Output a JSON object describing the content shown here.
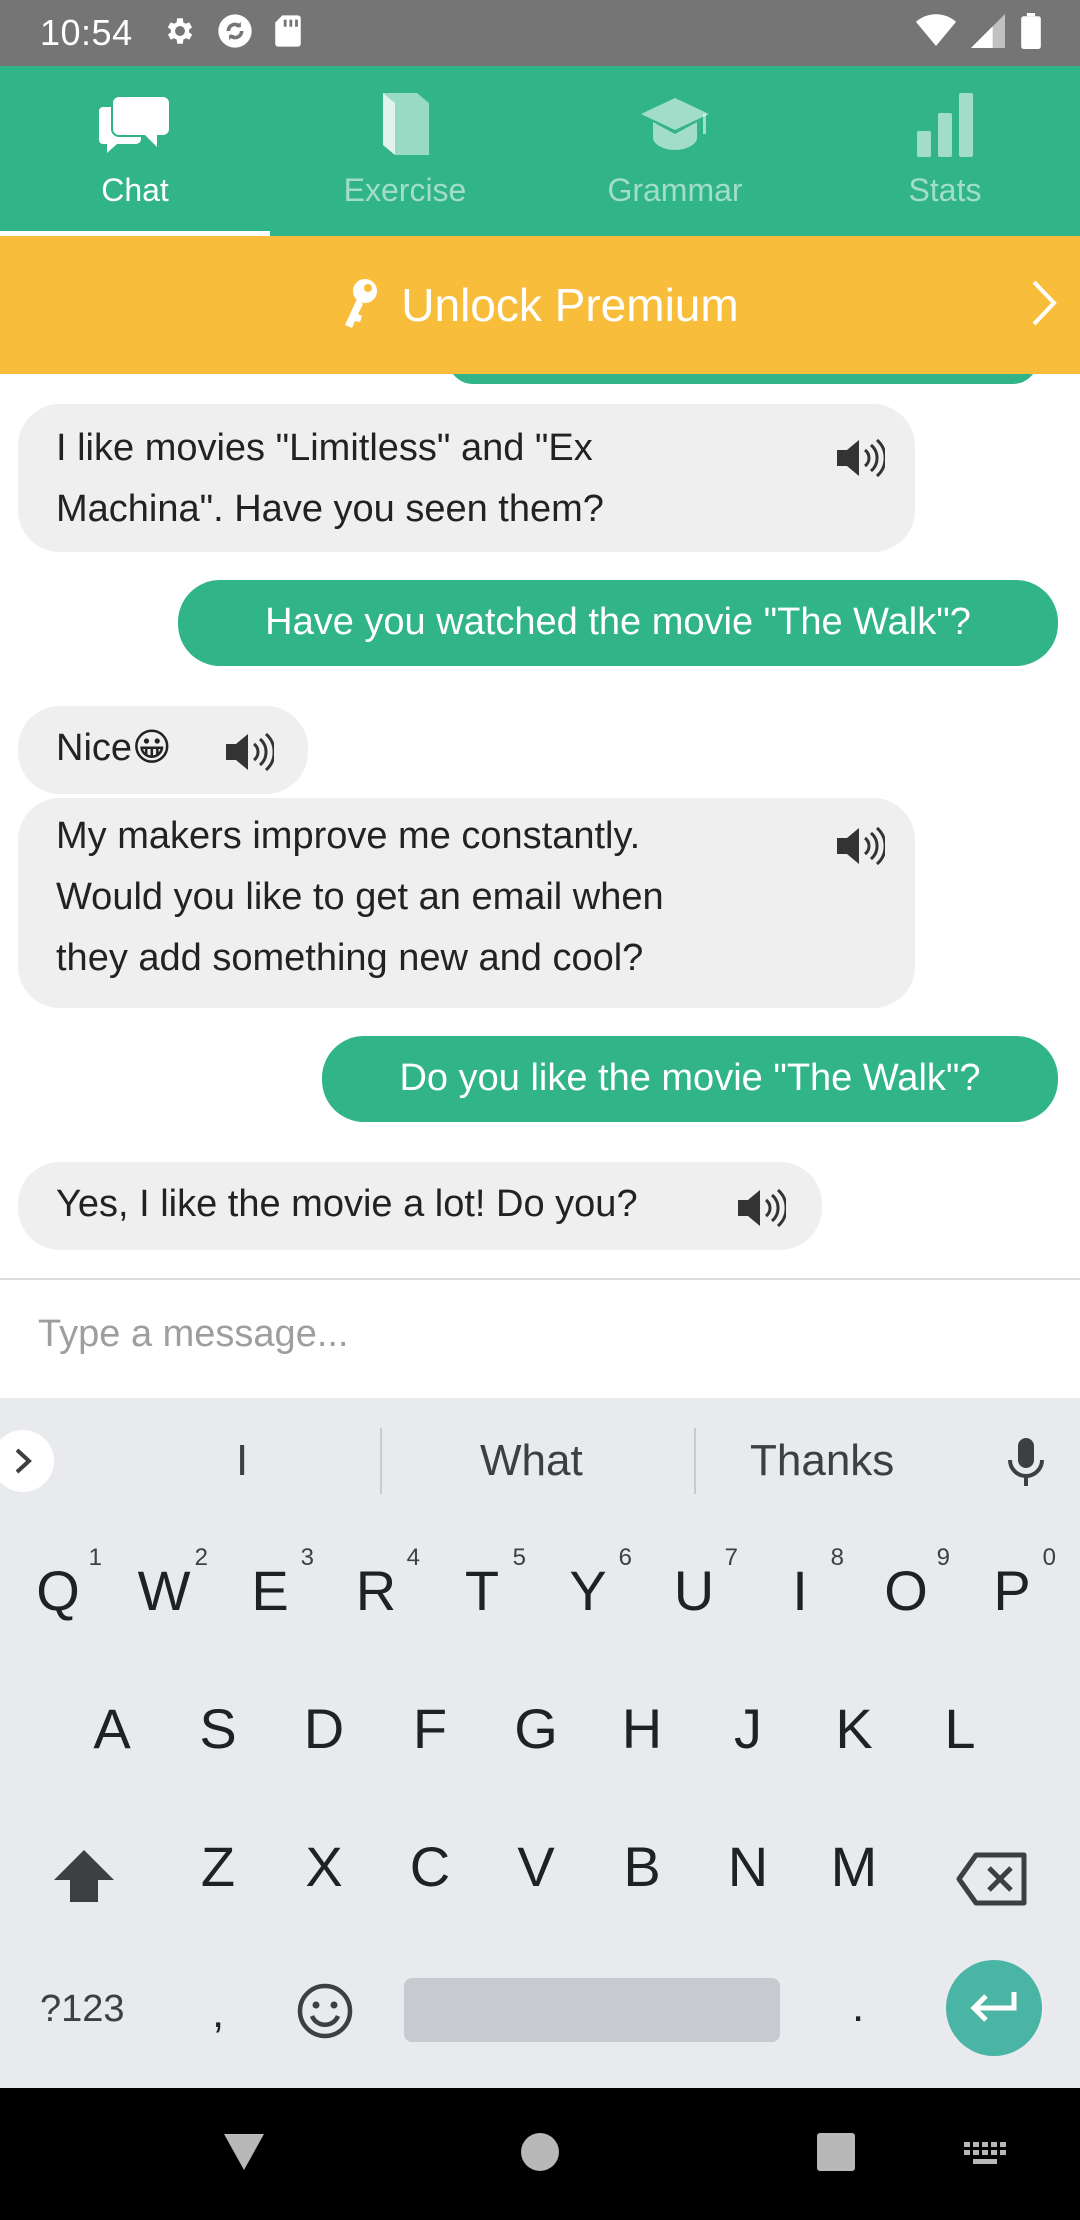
{
  "status_bar": {
    "time": "10:54",
    "icons": [
      "settings-icon",
      "sync-icon",
      "sd-card-icon",
      "wifi-icon",
      "signal-icon",
      "battery-icon"
    ]
  },
  "tabs": [
    {
      "label": "Chat",
      "icon": "chat-icon",
      "active": true
    },
    {
      "label": "Exercise",
      "icon": "book-icon",
      "active": false
    },
    {
      "label": "Grammar",
      "icon": "graduation-cap-icon",
      "active": false
    },
    {
      "label": "Stats",
      "icon": "bar-chart-icon",
      "active": false
    }
  ],
  "premium": {
    "label": "Unlock Premium",
    "icon": "key-icon"
  },
  "messages": [
    {
      "from": "bot",
      "text_line1": "I like movies \"Limitless\" and \"Ex",
      "text_line2": "Machina\". Have you seen them?"
    },
    {
      "from": "user",
      "text": "Have you watched the movie \"The Walk\"?"
    },
    {
      "from": "bot",
      "text": "Nice😀"
    },
    {
      "from": "bot",
      "text_line1": "My makers improve me constantly.",
      "text_line2": "Would you like to get an email when",
      "text_line3": "they add something new and cool?"
    },
    {
      "from": "user",
      "text": "Do you like the movie \"The Walk\"?"
    },
    {
      "from": "bot",
      "text": "Yes, I like the movie a lot! Do you?"
    }
  ],
  "composer": {
    "placeholder": "Type a message..."
  },
  "keyboard": {
    "suggestions": [
      "I",
      "What",
      "Thanks"
    ],
    "row1": [
      {
        "k": "Q",
        "n": "1"
      },
      {
        "k": "W",
        "n": "2"
      },
      {
        "k": "E",
        "n": "3"
      },
      {
        "k": "R",
        "n": "4"
      },
      {
        "k": "T",
        "n": "5"
      },
      {
        "k": "Y",
        "n": "6"
      },
      {
        "k": "U",
        "n": "7"
      },
      {
        "k": "I",
        "n": "8"
      },
      {
        "k": "O",
        "n": "9"
      },
      {
        "k": "P",
        "n": "0"
      }
    ],
    "row2": [
      "A",
      "S",
      "D",
      "F",
      "G",
      "H",
      "J",
      "K",
      "L"
    ],
    "row3": [
      "Z",
      "X",
      "C",
      "V",
      "B",
      "N",
      "M"
    ],
    "symbols_label": "?123",
    "comma": ",",
    "period": "."
  },
  "colors": {
    "brand_green": "#30b488",
    "premium_yellow": "#f8bd3a",
    "bot_bubble": "#efefef",
    "enter_key": "#4ab5a4"
  }
}
